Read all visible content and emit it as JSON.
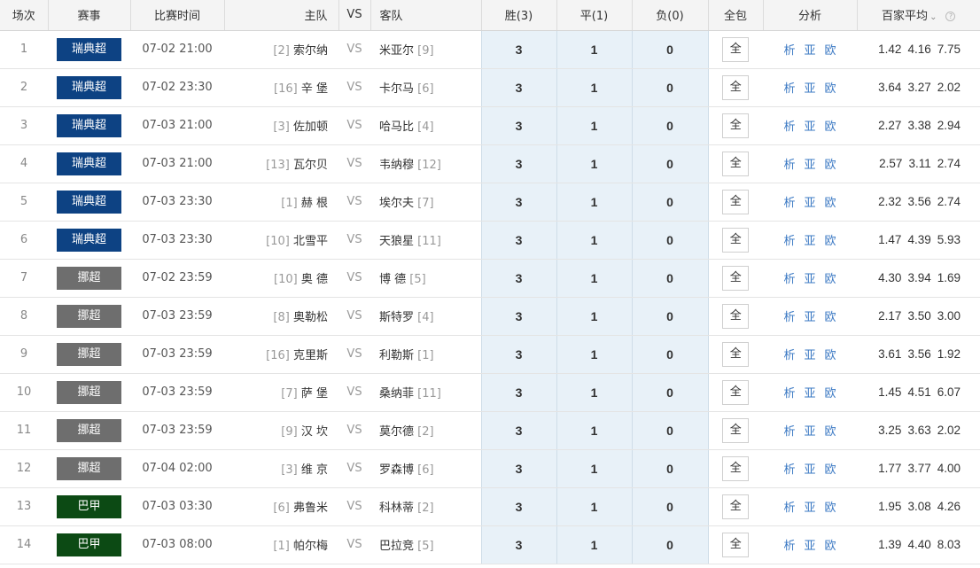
{
  "header": {
    "index": "场次",
    "league": "赛事",
    "time": "比赛时间",
    "home": "主队",
    "vs": "VS",
    "away": "客队",
    "win": "胜(3)",
    "draw": "平(1)",
    "loss": "负(0)",
    "all": "全包",
    "analysis": "分析",
    "avg": "百家平均",
    "avg_chevron_icon": "chevron-down-icon",
    "help_icon": "help-icon",
    "help_glyph": "?"
  },
  "colors": {
    "瑞典超": "#0d4283",
    "挪超": "#6e6e6e",
    "巴甲": "#0c4a14"
  },
  "rows": [
    {
      "idx": "1",
      "league": "瑞典超",
      "time": "07-02 21:00",
      "home_rank": "[2]",
      "home": "索尔纳",
      "vs": "VS",
      "away": "米亚尔",
      "away_rank": "[9]",
      "w": "3",
      "d": "1",
      "l": "0",
      "all": "全",
      "a1": "析",
      "a2": "亚",
      "a3": "欧",
      "o1": "1.42",
      "o2": "4.16",
      "o3": "7.75"
    },
    {
      "idx": "2",
      "league": "瑞典超",
      "time": "07-02 23:30",
      "home_rank": "[16]",
      "home": "辛 堡",
      "vs": "VS",
      "away": "卡尔马",
      "away_rank": "[6]",
      "w": "3",
      "d": "1",
      "l": "0",
      "all": "全",
      "a1": "析",
      "a2": "亚",
      "a3": "欧",
      "o1": "3.64",
      "o2": "3.27",
      "o3": "2.02"
    },
    {
      "idx": "3",
      "league": "瑞典超",
      "time": "07-03 21:00",
      "home_rank": "[3]",
      "home": "佐加顿",
      "vs": "VS",
      "away": "哈马比",
      "away_rank": "[4]",
      "w": "3",
      "d": "1",
      "l": "0",
      "all": "全",
      "a1": "析",
      "a2": "亚",
      "a3": "欧",
      "o1": "2.27",
      "o2": "3.38",
      "o3": "2.94"
    },
    {
      "idx": "4",
      "league": "瑞典超",
      "time": "07-03 21:00",
      "home_rank": "[13]",
      "home": "瓦尔贝",
      "vs": "VS",
      "away": "韦纳穆",
      "away_rank": "[12]",
      "w": "3",
      "d": "1",
      "l": "0",
      "all": "全",
      "a1": "析",
      "a2": "亚",
      "a3": "欧",
      "o1": "2.57",
      "o2": "3.11",
      "o3": "2.74"
    },
    {
      "idx": "5",
      "league": "瑞典超",
      "time": "07-03 23:30",
      "home_rank": "[1]",
      "home": "赫 根",
      "vs": "VS",
      "away": "埃尔夫",
      "away_rank": "[7]",
      "w": "3",
      "d": "1",
      "l": "0",
      "all": "全",
      "a1": "析",
      "a2": "亚",
      "a3": "欧",
      "o1": "2.32",
      "o2": "3.56",
      "o3": "2.74"
    },
    {
      "idx": "6",
      "league": "瑞典超",
      "time": "07-03 23:30",
      "home_rank": "[10]",
      "home": "北雪平",
      "vs": "VS",
      "away": "天狼星",
      "away_rank": "[11]",
      "w": "3",
      "d": "1",
      "l": "0",
      "all": "全",
      "a1": "析",
      "a2": "亚",
      "a3": "欧",
      "o1": "1.47",
      "o2": "4.39",
      "o3": "5.93"
    },
    {
      "idx": "7",
      "league": "挪超",
      "time": "07-02 23:59",
      "home_rank": "[10]",
      "home": "奥 德",
      "vs": "VS",
      "away": "博 德",
      "away_rank": "[5]",
      "w": "3",
      "d": "1",
      "l": "0",
      "all": "全",
      "a1": "析",
      "a2": "亚",
      "a3": "欧",
      "o1": "4.30",
      "o2": "3.94",
      "o3": "1.69"
    },
    {
      "idx": "8",
      "league": "挪超",
      "time": "07-03 23:59",
      "home_rank": "[8]",
      "home": "奥勒松",
      "vs": "VS",
      "away": "斯特罗",
      "away_rank": "[4]",
      "w": "3",
      "d": "1",
      "l": "0",
      "all": "全",
      "a1": "析",
      "a2": "亚",
      "a3": "欧",
      "o1": "2.17",
      "o2": "3.50",
      "o3": "3.00"
    },
    {
      "idx": "9",
      "league": "挪超",
      "time": "07-03 23:59",
      "home_rank": "[16]",
      "home": "克里斯",
      "vs": "VS",
      "away": "利勒斯",
      "away_rank": "[1]",
      "w": "3",
      "d": "1",
      "l": "0",
      "all": "全",
      "a1": "析",
      "a2": "亚",
      "a3": "欧",
      "o1": "3.61",
      "o2": "3.56",
      "o3": "1.92"
    },
    {
      "idx": "10",
      "league": "挪超",
      "time": "07-03 23:59",
      "home_rank": "[7]",
      "home": "萨 堡",
      "vs": "VS",
      "away": "桑纳菲",
      "away_rank": "[11]",
      "w": "3",
      "d": "1",
      "l": "0",
      "all": "全",
      "a1": "析",
      "a2": "亚",
      "a3": "欧",
      "o1": "1.45",
      "o2": "4.51",
      "o3": "6.07"
    },
    {
      "idx": "11",
      "league": "挪超",
      "time": "07-03 23:59",
      "home_rank": "[9]",
      "home": "汉 坎",
      "vs": "VS",
      "away": "莫尔德",
      "away_rank": "[2]",
      "w": "3",
      "d": "1",
      "l": "0",
      "all": "全",
      "a1": "析",
      "a2": "亚",
      "a3": "欧",
      "o1": "3.25",
      "o2": "3.63",
      "o3": "2.02"
    },
    {
      "idx": "12",
      "league": "挪超",
      "time": "07-04 02:00",
      "home_rank": "[3]",
      "home": "维 京",
      "vs": "VS",
      "away": "罗森博",
      "away_rank": "[6]",
      "w": "3",
      "d": "1",
      "l": "0",
      "all": "全",
      "a1": "析",
      "a2": "亚",
      "a3": "欧",
      "o1": "1.77",
      "o2": "3.77",
      "o3": "4.00"
    },
    {
      "idx": "13",
      "league": "巴甲",
      "time": "07-03 03:30",
      "home_rank": "[6]",
      "home": "弗鲁米",
      "vs": "VS",
      "away": "科林蒂",
      "away_rank": "[2]",
      "w": "3",
      "d": "1",
      "l": "0",
      "all": "全",
      "a1": "析",
      "a2": "亚",
      "a3": "欧",
      "o1": "1.95",
      "o2": "3.08",
      "o3": "4.26"
    },
    {
      "idx": "14",
      "league": "巴甲",
      "time": "07-03 08:00",
      "home_rank": "[1]",
      "home": "帕尔梅",
      "vs": "VS",
      "away": "巴拉竞",
      "away_rank": "[5]",
      "w": "3",
      "d": "1",
      "l": "0",
      "all": "全",
      "a1": "析",
      "a2": "亚",
      "a3": "欧",
      "o1": "1.39",
      "o2": "4.40",
      "o3": "8.03"
    }
  ]
}
